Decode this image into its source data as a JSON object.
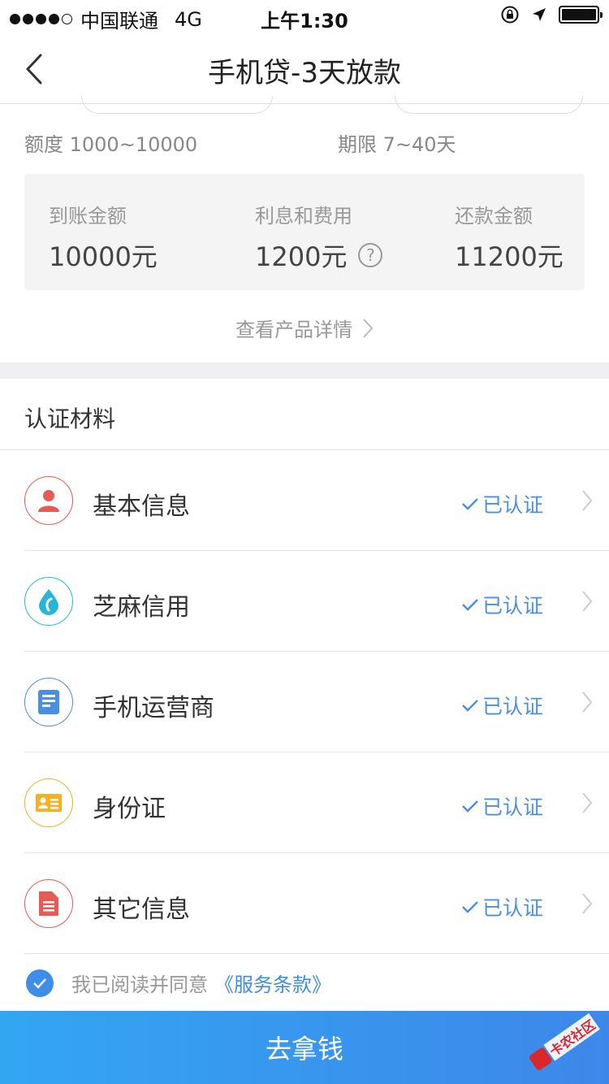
{
  "status_bar": {
    "carrier": "中国联通",
    "network": "4G",
    "time": "上午1:30"
  },
  "nav": {
    "title": "手机贷-3天放款"
  },
  "loan": {
    "amount_range": "额度 1000~10000",
    "term_range": "期限 7~40天"
  },
  "summary": {
    "received_label": "到账金额",
    "received_value": "10000元",
    "fee_label": "利息和费用",
    "fee_value": "1200元",
    "repay_label": "还款金额",
    "repay_value": "11200元"
  },
  "detail_link": "查看产品详情",
  "section_title": "认证材料",
  "verified_text": "已认证",
  "cert_items": [
    {
      "label": "基本信息",
      "icon": "user-icon",
      "color": "#e85a55"
    },
    {
      "label": "芝麻信用",
      "icon": "sesame-credit-icon",
      "color": "#27b6d7"
    },
    {
      "label": "手机运营商",
      "icon": "phone-carrier-icon",
      "color": "#4a8fe0"
    },
    {
      "label": "身份证",
      "icon": "id-card-icon",
      "color": "#f4b223"
    },
    {
      "label": "其它信息",
      "icon": "document-icon",
      "color": "#e85a55"
    }
  ],
  "agreement": {
    "text": "我已阅读并同意",
    "link": "《服务条款》",
    "checked": true
  },
  "cta_label": "去拿钱",
  "watermark_text": "卡农社区",
  "colors": {
    "accent": "#3e8de8",
    "cta_start": "#33a6f2",
    "cta_end": "#3d87ea",
    "band": "#efeff4"
  }
}
